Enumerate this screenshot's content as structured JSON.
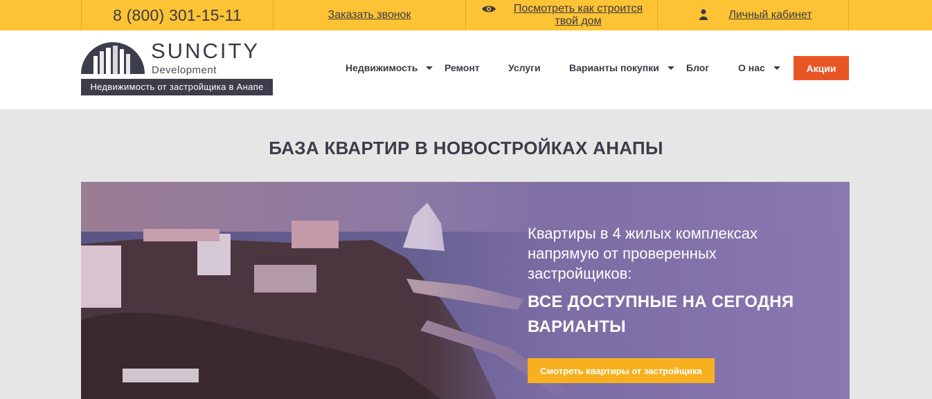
{
  "topbar": {
    "phone": "8 (800) 301-15-11",
    "callback_link": "Заказать звонок",
    "construction_link": "Посмотреть как строится твой дом",
    "cabinet_link": "Личный кабинет",
    "icons": [
      "eye-icon",
      "user-icon"
    ]
  },
  "header": {
    "brand": "SUNCITY",
    "brand_sub": "Development",
    "tagline": "Недвижимость от застройщика в Анапе",
    "nav": [
      {
        "label": "Недвижимость",
        "has_dropdown": true
      },
      {
        "label": "Ремонт",
        "has_dropdown": false
      },
      {
        "label": "Услуги",
        "has_dropdown": false
      },
      {
        "label": "Варианты покупки",
        "has_dropdown": true
      },
      {
        "label": "Блог",
        "has_dropdown": false
      },
      {
        "label": "О нас",
        "has_dropdown": true
      }
    ],
    "promo_button": "Акции"
  },
  "page": {
    "title": "БАЗА КВАРТИР В НОВОСТРОЙКАХ АНАПЫ"
  },
  "hero": {
    "text": "Квартиры в 4 жилых комплексах напрямую от проверенных застройщиков:",
    "headline": "ВСЕ ДОСТУПНЫЕ НА СЕГОДНЯ ВАРИАНТЫ",
    "button": "Смотреть квартиры от застройщика"
  },
  "colors": {
    "topbar": "#fdc335",
    "promo": "#e95625",
    "hero_button": "#f7b11f",
    "dark": "#3d3e4c"
  }
}
